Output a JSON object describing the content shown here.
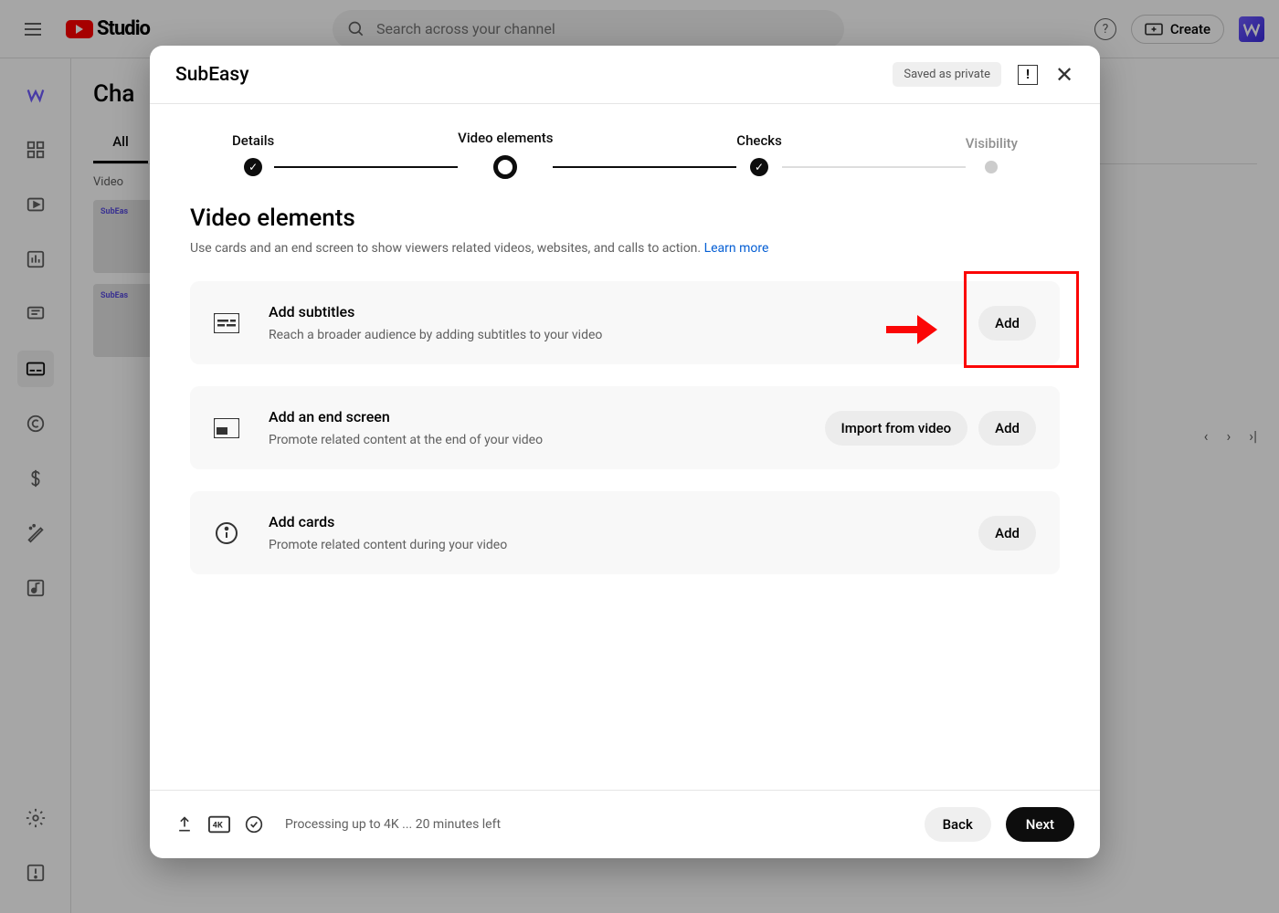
{
  "topbar": {
    "logo_text": "Studio",
    "search_placeholder": "Search across your channel",
    "help_symbol": "?",
    "create_label": "Create"
  },
  "page": {
    "title_truncated": "Cha",
    "tabs": {
      "all": "All"
    },
    "column_header": "Video",
    "thumb_brand": "SubEas"
  },
  "modal": {
    "title": "SubEasy",
    "saved_chip": "Saved as private",
    "feedback_symbol": "!",
    "steps": {
      "details": "Details",
      "elements": "Video elements",
      "checks": "Checks",
      "visibility": "Visibility"
    },
    "section_title": "Video elements",
    "section_desc_prefix": "Use cards and an end screen to show viewers related videos, websites, and calls to action. ",
    "learn_more": "Learn more",
    "cards": {
      "subtitles": {
        "title": "Add subtitles",
        "desc": "Reach a broader audience by adding subtitles to your video",
        "add": "Add"
      },
      "endscreen": {
        "title": "Add an end screen",
        "desc": "Promote related content at the end of your video",
        "import": "Import from video",
        "add": "Add"
      },
      "infocards": {
        "title": "Add cards",
        "desc": "Promote related content during your video",
        "add": "Add"
      }
    },
    "footer": {
      "status": "Processing up to 4K ... 20 minutes left",
      "back": "Back",
      "next": "Next"
    }
  }
}
